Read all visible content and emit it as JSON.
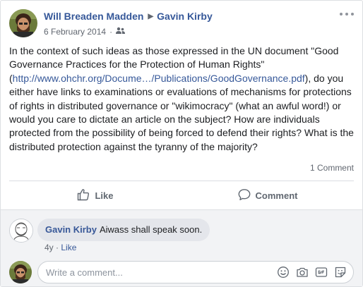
{
  "post": {
    "author": "Will Breaden Madden",
    "recipient": "Gavin Kirby",
    "date": "6 February 2014",
    "text_before_link": "In the context of such ideas as those expressed in the UN document \"Good Governance Practices for the Protection of Human Rights\" (",
    "link_text": "http://www.ohchr.org/Docume…/Publications/GoodGovernance.pdf",
    "text_after_link": "), do you either have links to examinations or evaluations of mechanisms for protections of rights in distributed governance or \"wikimocracy\" (what an awful word!) or would you care to dictate an article on the subject? How are individuals protected from the possibility of being forced to defend their rights? What is the distributed protection against the tyranny of the majority?",
    "comment_count": "1 Comment"
  },
  "actions": {
    "like_label": "Like",
    "comment_label": "Comment"
  },
  "comment": {
    "author": "Gavin Kirby",
    "text": "Aiwass shall speak soon.",
    "age": "4y",
    "separator": "·",
    "like_label": "Like"
  },
  "composer": {
    "placeholder": "Write a comment..."
  },
  "colors": {
    "link": "#365899",
    "muted": "#616770",
    "bubble": "#e4e6eb"
  },
  "icons": {
    "audience": "friends-icon",
    "more": "more-dots-icon",
    "like": "thumbs-up-icon",
    "comment": "speech-bubble-icon",
    "emoji": "emoji-icon",
    "camera": "camera-icon",
    "gif": "gif-icon",
    "sticker": "sticker-icon"
  }
}
